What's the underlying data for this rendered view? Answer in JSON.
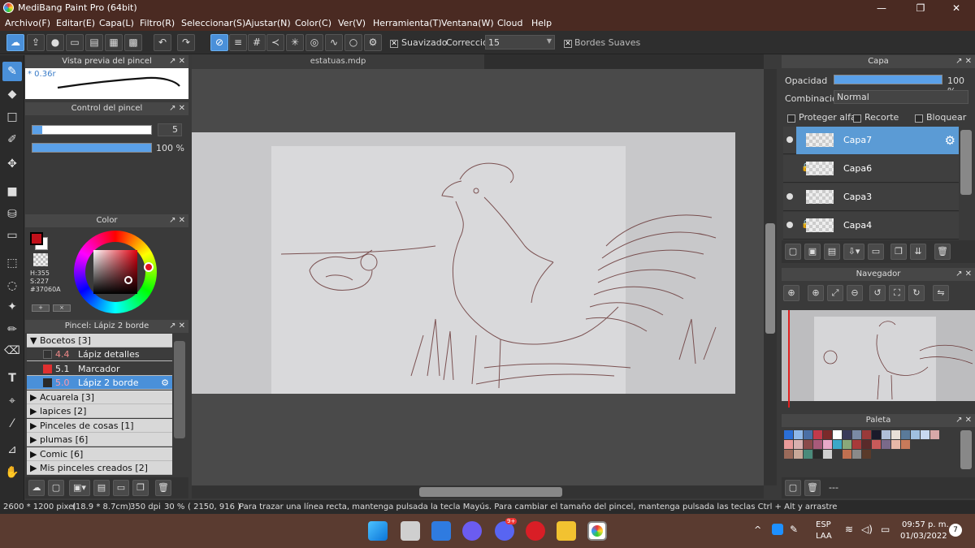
{
  "window": {
    "title": "MediBang Paint Pro (64bit)"
  },
  "menu": [
    "Archivo(F)",
    "Editar(E)",
    "Capa(L)",
    "Filtro(R)",
    "Seleccionar(S)",
    "Ajustar(N)",
    "Color(C)",
    "Ver(V)",
    "Herramienta(T)",
    "Ventana(W)",
    "Cloud",
    "Help"
  ],
  "toolbar": {
    "smoothing_label": "Suavizado",
    "correction_label": "Corrección",
    "correction_value": "15",
    "soft_edges_label": "Bordes Suaves"
  },
  "brush_preview": {
    "title": "Vista previa del pincel",
    "size": "* 0.36r"
  },
  "brush_control": {
    "title": "Control del pincel",
    "size_value": "5",
    "opacity_value": "100 %"
  },
  "color_panel": {
    "title": "Color",
    "h": "H:355",
    "s": "S:227",
    "hex": "#37060A",
    "primary": "#c0101a",
    "secondary": "#ffffff"
  },
  "brush_panel": {
    "title": "Pincel: Lápiz 2 borde",
    "groups": [
      {
        "label": "Bocetos [3]",
        "expanded": true
      },
      {
        "label": "Acuarela [3]"
      },
      {
        "label": "lapices [2]"
      },
      {
        "label": "Pinceles de cosas [1]"
      },
      {
        "label": "plumas [6]"
      },
      {
        "label": "Comic  [6]"
      },
      {
        "label": "Mis pinceles creados  [2]"
      }
    ],
    "sub_items": [
      {
        "size": "4.4",
        "name": "Lápiz detalles"
      },
      {
        "size": "5.1",
        "name": "Marcador"
      },
      {
        "size": "5.0",
        "name": "Lápiz 2 borde"
      }
    ]
  },
  "document": {
    "tab": "estatuas.mdp"
  },
  "layers_panel": {
    "title": "Capa",
    "opacity_label": "Opacidad",
    "opacity_value": "100 %",
    "blend_label": "Combinación",
    "blend_value": "Normal",
    "protect_alpha": "Proteger alfa",
    "clip": "Recorte",
    "lock": "Bloquear",
    "layers": [
      "Capa7",
      "Capa6",
      "Capa3",
      "Capa4"
    ]
  },
  "navigator": {
    "title": "Navegador"
  },
  "palette": {
    "title": "Paleta",
    "footer": "---"
  },
  "status": {
    "size": "2600 * 1200 pixel",
    "cm": "(18.9 * 8.7cm)",
    "dpi": "350 dpi",
    "zoom": "30 %",
    "coords": "( 2150, 916 )",
    "hint": "Para trazar una línea recta, mantenga pulsada la tecla Mayús. Para cambiar el tamaño del pincel, mantenga pulsada las teclas Ctrl + Alt y arrastre"
  },
  "taskbar": {
    "lang1": "ESP",
    "lang2": "LAA",
    "time": "09:57 p. m.",
    "date": "01/03/2022",
    "badge": "7",
    "discord_badge": "9+"
  }
}
